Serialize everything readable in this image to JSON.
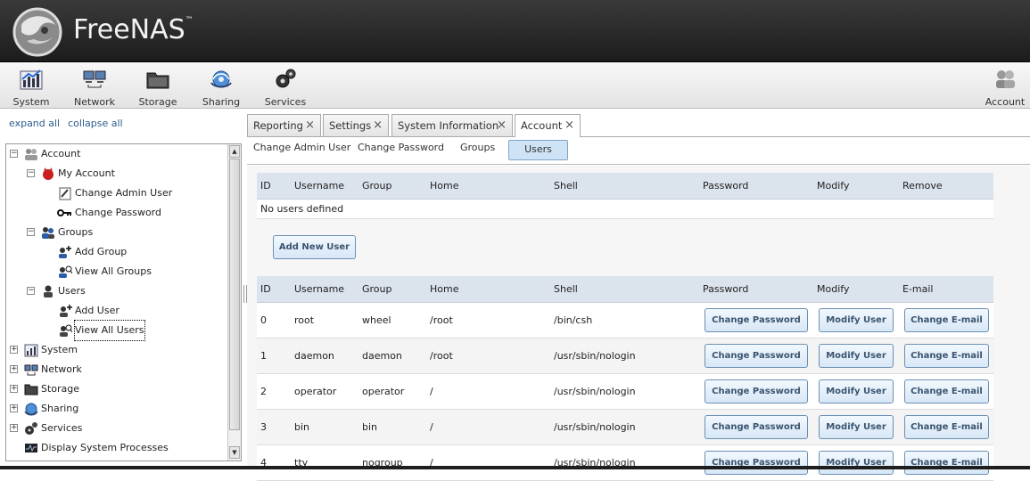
{
  "brand": {
    "name": "FreeNAS",
    "tm": "™"
  },
  "toolbar": {
    "items": [
      {
        "label": "System",
        "icon": "system-chart-icon"
      },
      {
        "label": "Network",
        "icon": "network-computers-icon"
      },
      {
        "label": "Storage",
        "icon": "storage-folder-icon"
      },
      {
        "label": "Sharing",
        "icon": "sharing-globe-icon"
      },
      {
        "label": "Services",
        "icon": "services-gears-icon"
      }
    ],
    "account_label": "Account"
  },
  "tree_links": {
    "expand": "expand all",
    "collapse": "collapse all"
  },
  "tree": {
    "account": "Account",
    "my_account": "My Account",
    "change_admin_user": "Change Admin User",
    "change_password": "Change Password",
    "groups": "Groups",
    "add_group": "Add Group",
    "view_all_groups": "View All Groups",
    "users": "Users",
    "add_user": "Add User",
    "view_all_users": "View All Users",
    "system": "System",
    "network": "Network",
    "storage": "Storage",
    "sharing": "Sharing",
    "services": "Services",
    "display_processes": "Display System Processes"
  },
  "tabs": [
    "Reporting",
    "Settings",
    "System Information",
    "Account"
  ],
  "subnav": [
    "Change Admin User",
    "Change Password",
    "Groups",
    "Users"
  ],
  "groups_table": {
    "columns": [
      "ID",
      "Username",
      "Group",
      "Home",
      "Shell",
      "Password",
      "Modify",
      "Remove"
    ],
    "empty": "No users defined"
  },
  "add_new_user_button": "Add New User",
  "users_table": {
    "columns": [
      "ID",
      "Username",
      "Group",
      "Home",
      "Shell",
      "Password",
      "Modify",
      "E-mail"
    ],
    "rows": [
      {
        "id": "0",
        "username": "root",
        "group": "wheel",
        "home": "/root",
        "shell": "/bin/csh"
      },
      {
        "id": "1",
        "username": "daemon",
        "group": "daemon",
        "home": "/root",
        "shell": "/usr/sbin/nologin"
      },
      {
        "id": "2",
        "username": "operator",
        "group": "operator",
        "home": "/",
        "shell": "/usr/sbin/nologin"
      },
      {
        "id": "3",
        "username": "bin",
        "group": "bin",
        "home": "/",
        "shell": "/usr/sbin/nologin"
      },
      {
        "id": "4",
        "username": "tty",
        "group": "nogroup",
        "home": "/",
        "shell": "/usr/sbin/nologin"
      }
    ],
    "change_password": "Change Password",
    "modify_user": "Modify User",
    "change_email": "Change E-mail"
  }
}
